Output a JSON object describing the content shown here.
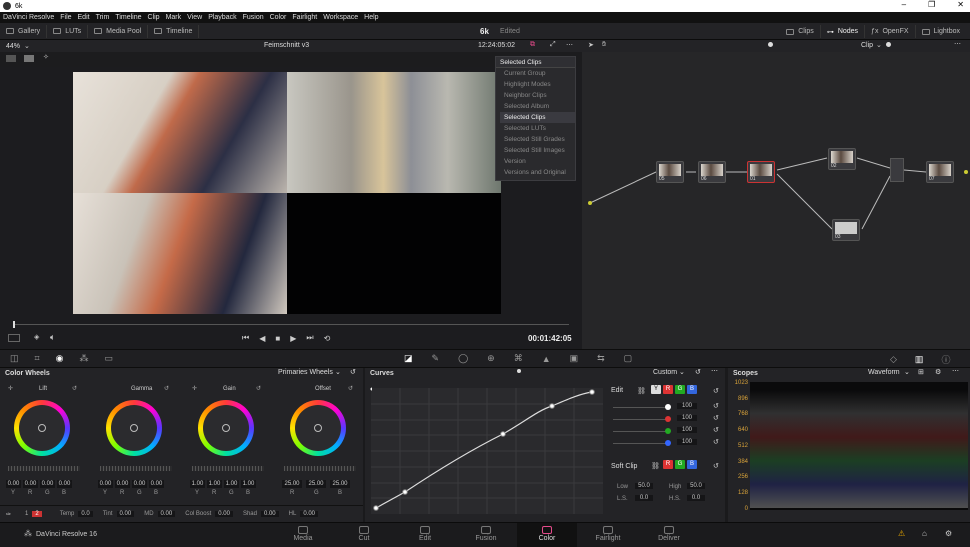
{
  "window": {
    "title": "6k"
  },
  "menu": [
    "DaVinci Resolve",
    "File",
    "Edit",
    "Trim",
    "Timeline",
    "Clip",
    "Mark",
    "View",
    "Playback",
    "Fusion",
    "Color",
    "Fairlight",
    "Workspace",
    "Help"
  ],
  "toolbar": {
    "left": [
      "Gallery",
      "LUTs",
      "Media Pool",
      "Timeline"
    ],
    "project": "6k",
    "status": "Edited",
    "right": [
      "Clips",
      "Nodes",
      "OpenFX",
      "Lightbox"
    ]
  },
  "viewer": {
    "zoom": "44%",
    "timeline_name": "Feimschnitt v3",
    "timecode": "12:24:05:02",
    "playhead_tc": "00:01:42:05"
  },
  "dropdown": {
    "selected": "Selected Clips",
    "options": [
      "Current Group",
      "Highlight Modes",
      "Neighbor Clips",
      "Selected Album",
      "Selected Clips",
      "Selected LUTs",
      "Selected Still Grades",
      "Selected Still Images",
      "Version",
      "Versions and Original"
    ]
  },
  "nodes": {
    "mode": "Clip",
    "items": [
      "05",
      "06",
      "01",
      "02",
      "03",
      "07"
    ]
  },
  "color_wheels": {
    "title": "Color Wheels",
    "mode": "Primaries Wheels",
    "wheels": [
      {
        "name": "Lift",
        "values": [
          "0.00",
          "0.00",
          "0.00",
          "0.00"
        ]
      },
      {
        "name": "Gamma",
        "values": [
          "0.00",
          "0.00",
          "0.00",
          "0.00"
        ]
      },
      {
        "name": "Gain",
        "values": [
          "1.00",
          "1.00",
          "1.00",
          "1.00"
        ]
      },
      {
        "name": "Offset",
        "values": [
          "25.00",
          "25.00",
          "25.00"
        ]
      }
    ],
    "channels4": [
      "Y",
      "R",
      "G",
      "B"
    ],
    "channels3": [
      "R",
      "G",
      "B"
    ],
    "bottom": {
      "page1": "1",
      "page2": "2",
      "temp_label": "Temp",
      "temp": "0.0",
      "tint_label": "Tint",
      "tint": "0.00",
      "md_label": "MD",
      "md": "0.00",
      "boost_label": "Col Boost",
      "boost": "0.00",
      "shad_label": "Shad",
      "shad": "0.00",
      "hl_label": "HL",
      "hl": "0.00"
    }
  },
  "curves": {
    "title": "Curves",
    "mode": "Custom",
    "edit_label": "Edit",
    "edit_values": [
      "100",
      "100",
      "100",
      "100"
    ],
    "soft_clip": "Soft Clip",
    "low_label": "Low",
    "low": "50.0",
    "high_label": "High",
    "high": "50.0",
    "ls_label": "L.S.",
    "ls": "0.0",
    "hs_label": "H.S.",
    "hs": "0.0",
    "chan": [
      "Y",
      "R",
      "G",
      "B"
    ]
  },
  "scopes": {
    "title": "Scopes",
    "mode": "Waveform",
    "scale": [
      "1023",
      "896",
      "768",
      "640",
      "512",
      "384",
      "256",
      "128",
      "0"
    ]
  },
  "pages": [
    "Media",
    "Cut",
    "Edit",
    "Fusion",
    "Color",
    "Fairlight",
    "Deliver"
  ],
  "active_page": "Color",
  "brand": "DaVinci Resolve 16",
  "colors": {
    "accent": "#e64b8b",
    "red": "#d33",
    "green": "#2a2",
    "blue": "#36d"
  }
}
